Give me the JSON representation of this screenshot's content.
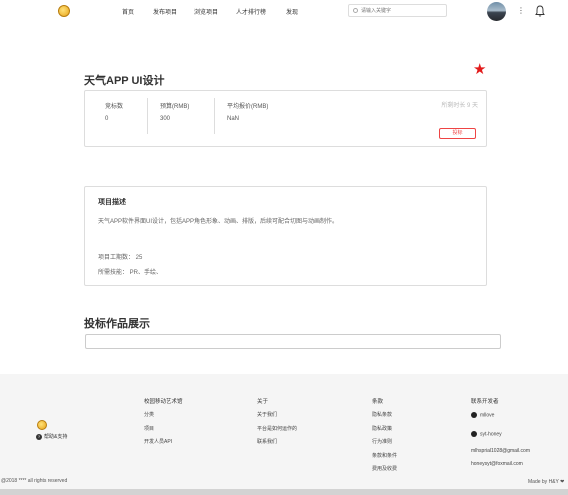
{
  "nav": {
    "items": [
      "首页",
      "发布项目",
      "浏览项目",
      "人才排行榜",
      "发现"
    ],
    "search_placeholder": "请输入关键字",
    "menu_dots": "⋮"
  },
  "project": {
    "title": "天气APP UI设计",
    "stats": {
      "bids_label": "竞标数",
      "bids_value": "0",
      "budget_label": "预算(RMB)",
      "budget_value": "300",
      "avg_label": "平均报价(RMB)",
      "avg_value": "NaN"
    },
    "remaining": "所剩时长 9 天",
    "bid_button": "投标"
  },
  "description": {
    "heading": "项目描述",
    "text": "天气APP软件界面UI设计，包括APP角色形象、动画、排版，后续可配合切图与动画制作。",
    "period": "项目工期数：  25",
    "skills": "所需技能：  PR、手绘、"
  },
  "works": {
    "title": "投标作品展示"
  },
  "footer": {
    "help": "帮助&支持",
    "columns": [
      {
        "heading": "校园移动艺术馆",
        "links": [
          "分类",
          "项目",
          "开发人员API"
        ]
      },
      {
        "heading": "关于",
        "links": [
          "关于我们",
          "平台是如何运作的",
          "联系我们"
        ]
      },
      {
        "heading": "条款",
        "links": [
          "隐私条款",
          "隐私政策",
          "行为准则",
          "条款和条件",
          "费用及收费"
        ]
      }
    ],
    "devs": {
      "heading": "联系开发者",
      "github1": "mllove",
      "github2": "syt-honey",
      "email1": "mlhsprial1028@gmail.com",
      "email2": "honeysyt@foxmail.com"
    },
    "copyright": "@2018 **** all rights reserved",
    "made_by": "Made by H&Y ❤"
  },
  "colors": {
    "accent_red": "#e21b1b",
    "border": "#dddddd",
    "footer_bg": "#f5f5f5"
  }
}
